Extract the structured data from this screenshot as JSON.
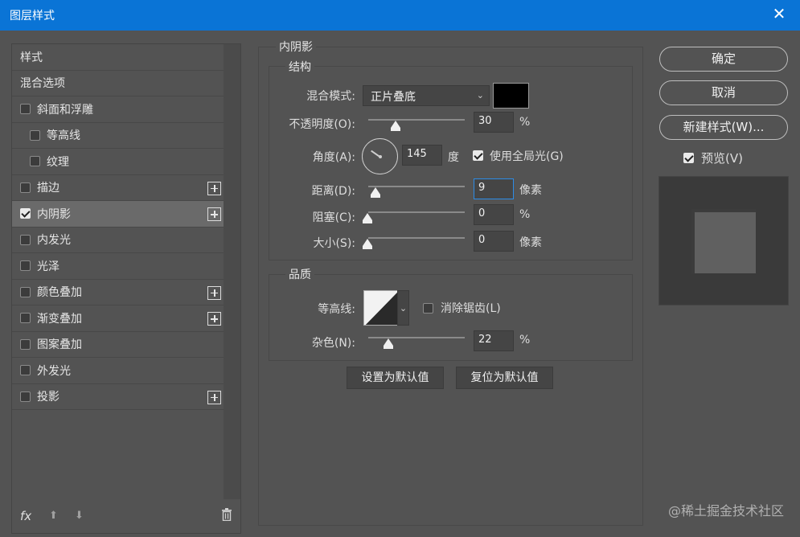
{
  "window": {
    "title": "图层样式",
    "close_symbol": "✕"
  },
  "styles_list": [
    {
      "label": "样式",
      "has_checkbox": false,
      "checked": false,
      "indent": false,
      "active": false,
      "has_plus": false
    },
    {
      "label": "混合选项",
      "has_checkbox": false,
      "checked": false,
      "indent": false,
      "active": false,
      "has_plus": false
    },
    {
      "label": "斜面和浮雕",
      "has_checkbox": true,
      "checked": false,
      "indent": false,
      "active": false,
      "has_plus": false
    },
    {
      "label": "等高线",
      "has_checkbox": true,
      "checked": false,
      "indent": true,
      "active": false,
      "has_plus": false
    },
    {
      "label": "纹理",
      "has_checkbox": true,
      "checked": false,
      "indent": true,
      "active": false,
      "has_plus": false
    },
    {
      "label": "描边",
      "has_checkbox": true,
      "checked": false,
      "indent": false,
      "active": false,
      "has_plus": true
    },
    {
      "label": "内阴影",
      "has_checkbox": true,
      "checked": true,
      "indent": false,
      "active": true,
      "has_plus": true
    },
    {
      "label": "内发光",
      "has_checkbox": true,
      "checked": false,
      "indent": false,
      "active": false,
      "has_plus": false
    },
    {
      "label": "光泽",
      "has_checkbox": true,
      "checked": false,
      "indent": false,
      "active": false,
      "has_plus": false
    },
    {
      "label": "颜色叠加",
      "has_checkbox": true,
      "checked": false,
      "indent": false,
      "active": false,
      "has_plus": true
    },
    {
      "label": "渐变叠加",
      "has_checkbox": true,
      "checked": false,
      "indent": false,
      "active": false,
      "has_plus": true
    },
    {
      "label": "图案叠加",
      "has_checkbox": true,
      "checked": false,
      "indent": false,
      "active": false,
      "has_plus": false
    },
    {
      "label": "外发光",
      "has_checkbox": true,
      "checked": false,
      "indent": false,
      "active": false,
      "has_plus": false
    },
    {
      "label": "投影",
      "has_checkbox": true,
      "checked": false,
      "indent": false,
      "active": false,
      "has_plus": true
    }
  ],
  "footer": {
    "fx": "fx",
    "up_symbol": "⬆",
    "down_symbol": "⬇"
  },
  "inner_shadow": {
    "section_title": "内阴影",
    "structure": {
      "title": "结构",
      "blend_mode_label": "混合模式:",
      "blend_mode_value": "正片叠底",
      "shadow_color": "#000000",
      "opacity_label": "不透明度(O):",
      "opacity_value": "30",
      "opacity_unit": "%",
      "angle_label": "角度(A):",
      "angle_value": "145",
      "angle_unit": "度",
      "global_light_label": "使用全局光(G)",
      "global_light_checked": true,
      "distance_label": "距离(D):",
      "distance_value": "9",
      "distance_unit": "像素",
      "choke_label": "阻塞(C):",
      "choke_value": "0",
      "choke_unit": "%",
      "size_label": "大小(S):",
      "size_value": "0",
      "size_unit": "像素"
    },
    "quality": {
      "title": "品质",
      "contour_label": "等高线:",
      "antialias_label": "消除锯齿(L)",
      "antialias_checked": false,
      "noise_label": "杂色(N):",
      "noise_value": "22",
      "noise_unit": "%"
    },
    "set_default_label": "设置为默认值",
    "reset_default_label": "复位为默认值"
  },
  "actions": {
    "ok_label": "确定",
    "cancel_label": "取消",
    "new_style_label": "新建样式(W)...",
    "preview_label": "预览(V)",
    "preview_checked": true
  },
  "watermark": "@稀土掘金技术社区"
}
